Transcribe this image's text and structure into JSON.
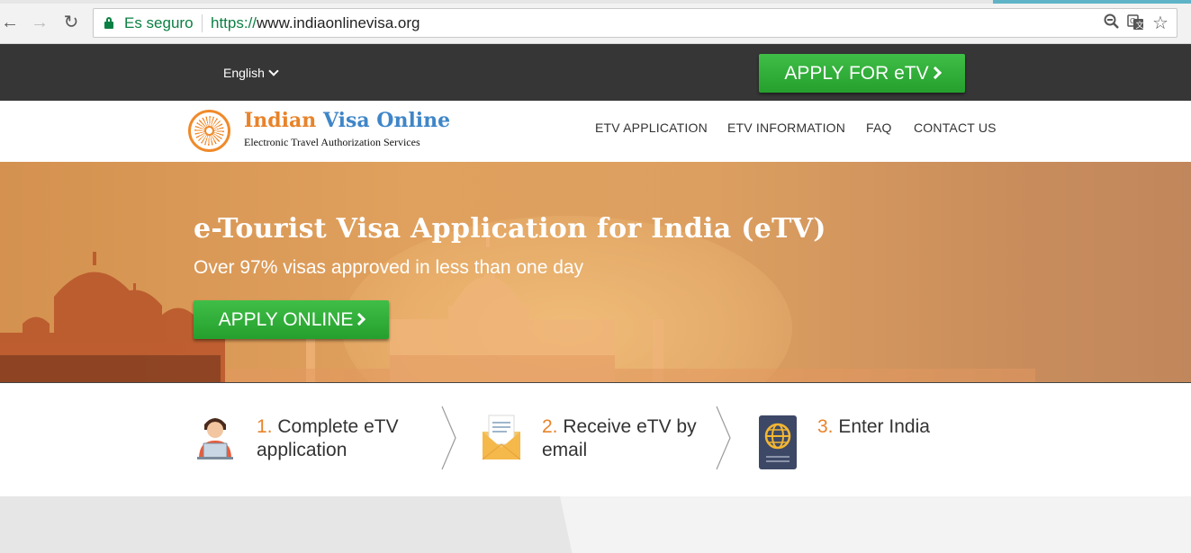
{
  "browser": {
    "secure_label": "Es seguro",
    "url_scheme": "https://",
    "url_host": "www.indiaonlinevisa.org"
  },
  "topbar": {
    "language": "English",
    "apply_button": "APPLY FOR eTV"
  },
  "header": {
    "brand_word1": "Indian",
    "brand_word2": "Visa Online",
    "tagline": "Electronic Travel Authorization Services",
    "nav": [
      "ETV APPLICATION",
      "ETV INFORMATION",
      "FAQ",
      "CONTACT US"
    ]
  },
  "hero": {
    "title": "e-Tourist Visa Application for India (eTV)",
    "subtitle": "Over 97% visas approved in less than one day",
    "apply_button": "APPLY ONLINE"
  },
  "steps": [
    {
      "num": "1.",
      "line1": "Complete eTV",
      "line2": "application",
      "icon": "person-laptop-icon"
    },
    {
      "num": "2.",
      "line1": "Receive eTV by",
      "line2": "email",
      "icon": "envelope-icon"
    },
    {
      "num": "3.",
      "line1": "Enter India",
      "line2": "",
      "icon": "passport-icon"
    }
  ],
  "colors": {
    "accent_orange": "#e8832a",
    "brand_blue": "#3f86c8",
    "button_green": "#2fae37",
    "topbar_dark": "#363636",
    "secure_green": "#0b8043"
  }
}
